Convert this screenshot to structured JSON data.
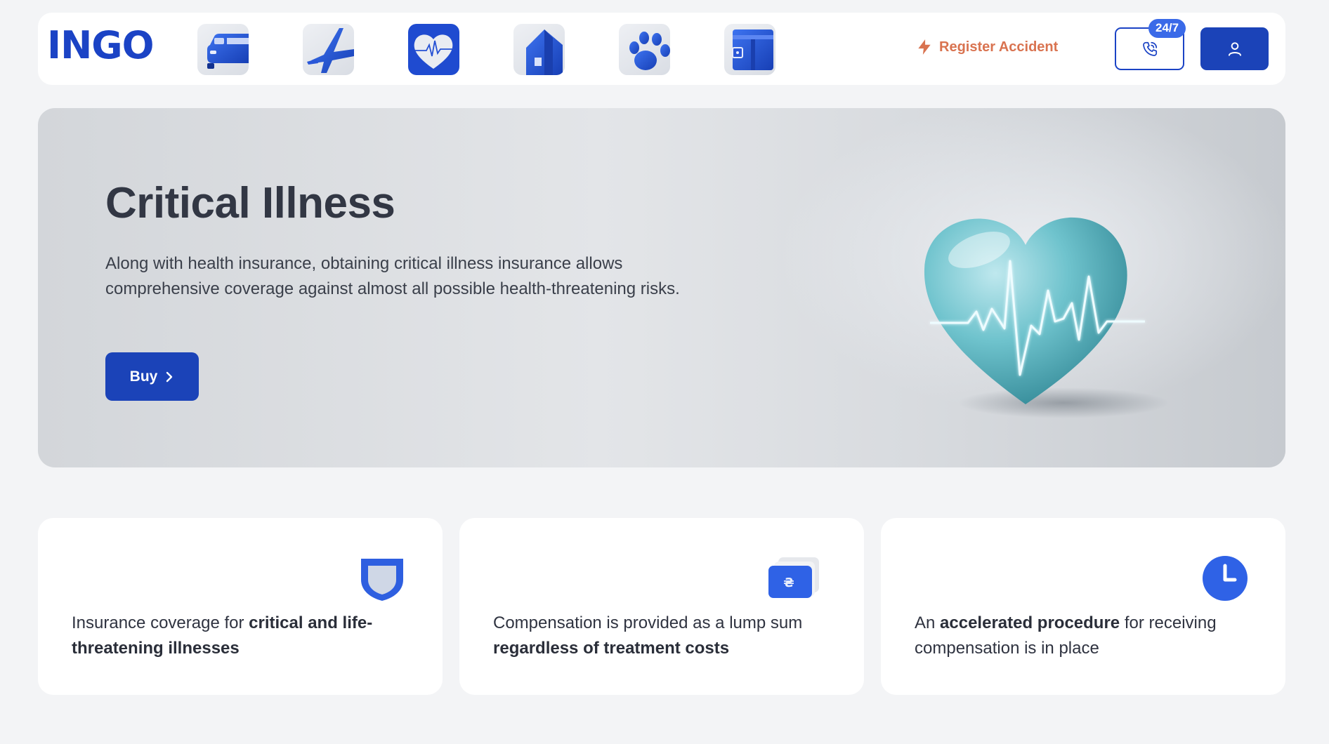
{
  "header": {
    "logo": "INGO",
    "nav_icons": [
      "car-insurance-icon",
      "travel-insurance-icon",
      "health-insurance-icon",
      "home-insurance-icon",
      "pet-insurance-icon",
      "wallet-insurance-icon"
    ],
    "register_accident": "Register Accident",
    "hotline_badge": "24/7",
    "accent_color": "#1b43c5",
    "register_color": "#d97350"
  },
  "hero": {
    "title": "Critical Illness",
    "description": "Along with health insurance, obtaining critical illness insurance allows comprehensive coverage against almost all possible health-threatening risks.",
    "buy_label": "Buy",
    "image": "heart-with-heartbeat-illustration"
  },
  "features": [
    {
      "icon": "shield-icon",
      "text_pre": "Insurance coverage for ",
      "text_bold": "critical and life-threatening illnesses",
      "text_post": ""
    },
    {
      "icon": "payment-cards-icon",
      "text_pre": "Compensation is provided as a lump sum ",
      "text_bold": "regardless of treatment costs",
      "text_post": ""
    },
    {
      "icon": "clock-icon",
      "text_pre": "An ",
      "text_bold": "accelerated procedure",
      "text_post": " for receiving compensation is in place"
    }
  ]
}
